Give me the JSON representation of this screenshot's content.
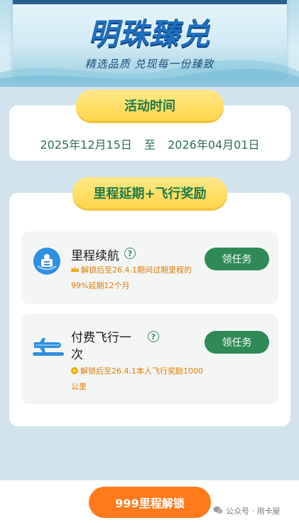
{
  "banner": {
    "title": "明珠臻兑",
    "subtitle": "精选品质 兑现每一份臻致"
  },
  "activity_time": {
    "heading": "活动时间",
    "start": "2025年12月15日",
    "separator": "至",
    "end": "2026年04月01日"
  },
  "rewards": {
    "heading": "里程延期+飞行奖励",
    "tasks": [
      {
        "title": "里程续航",
        "description": "解锁后至26.4.1期间过期里程的99%延期12个月",
        "button": "领任务",
        "icon": "passport-icon"
      },
      {
        "title": "付费飞行一次",
        "description": "解锁后至26.4.1本人飞行奖励1000公里",
        "button": "领任务",
        "icon": "airplane-icon"
      }
    ]
  },
  "footer": {
    "unlock_button": "999里程解锁",
    "watermark": "公众号 · 用卡屋"
  },
  "colors": {
    "accent_green": "#2f8a57",
    "pill_yellow": "#ffd64a",
    "unlock_orange": "#ff7a1a",
    "desc_orange": "#e07b00",
    "page_bg": "#d2e3ee"
  }
}
